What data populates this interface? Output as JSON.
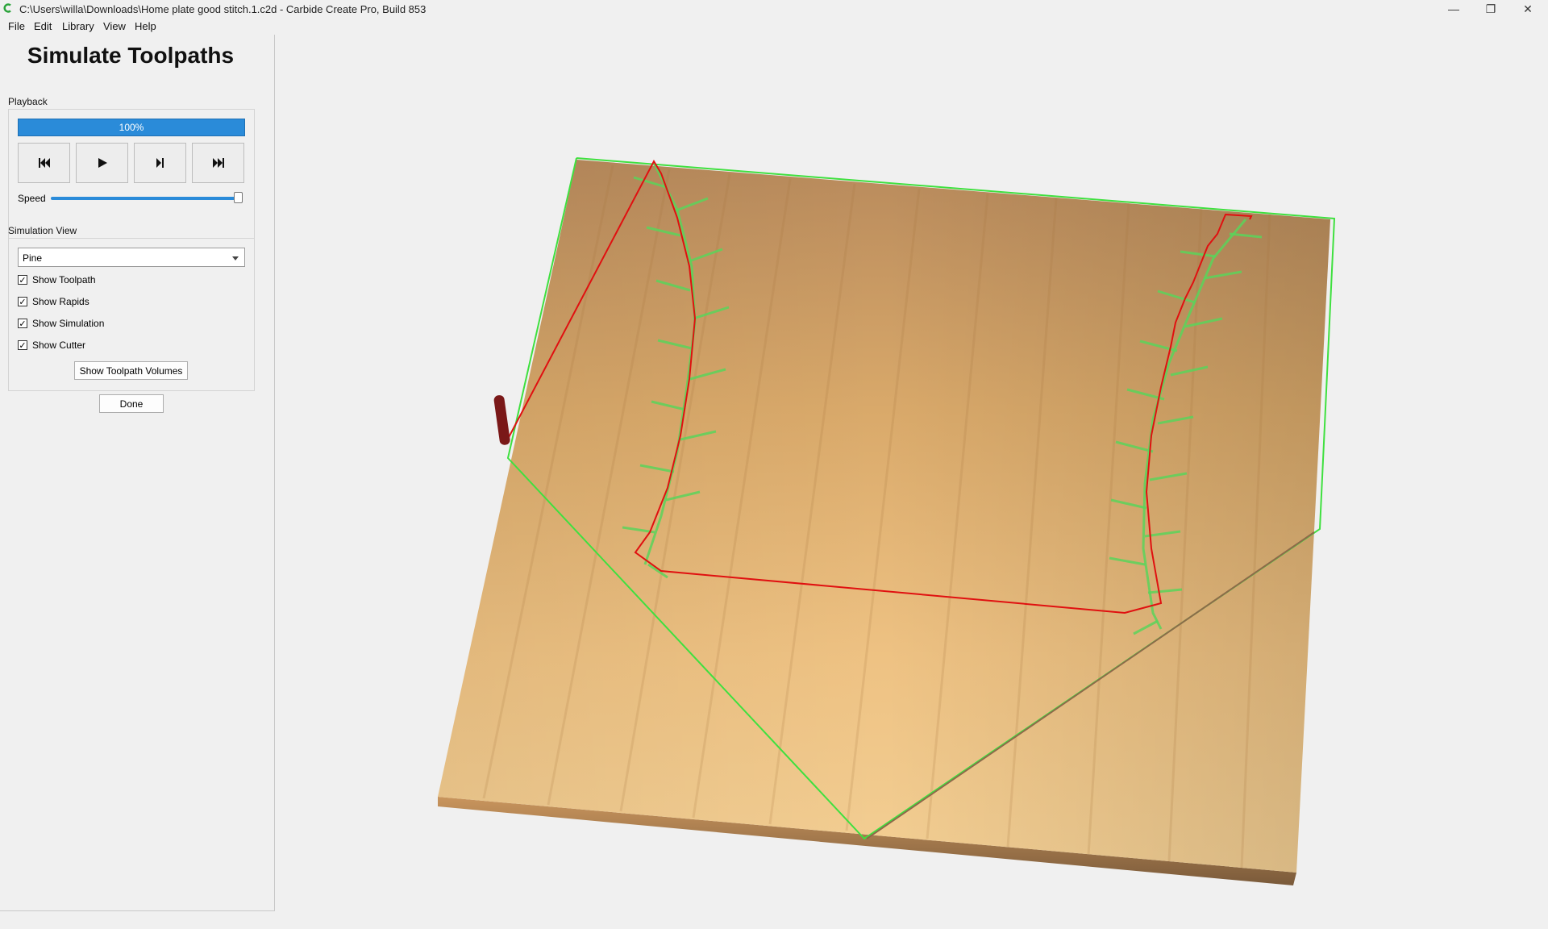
{
  "window": {
    "title": "C:\\Users\\willa\\Downloads\\Home plate good stitch.1.c2d - Carbide Create Pro, Build 853",
    "minimize_glyph": "—",
    "restore_glyph": "❐",
    "close_glyph": "✕"
  },
  "menu": [
    "File",
    "Edit",
    "Library",
    "View",
    "Help"
  ],
  "panel": {
    "title": "Simulate Toolpaths",
    "playback_label": "Playback",
    "progress_text": "100%",
    "progress_value": 100,
    "speed_label": "Speed",
    "speed_value": 100,
    "simulation_view_label": "Simulation View",
    "material_selected": "Pine",
    "checkboxes": [
      {
        "label": "Show Toolpath",
        "checked": true
      },
      {
        "label": "Show Rapids",
        "checked": true
      },
      {
        "label": "Show Simulation",
        "checked": true
      },
      {
        "label": "Show Cutter",
        "checked": true
      }
    ],
    "volumes_button": "Show Toolpath Volumes",
    "done_button": "Done"
  },
  "colors": {
    "progress_blue": "#2a8bd9",
    "toolpath_green": "#3fe03f",
    "rapid_red": "#e01010",
    "cutter": "#7a1818",
    "wood_light": "#f0c98a",
    "wood_dark": "#c8945a"
  }
}
